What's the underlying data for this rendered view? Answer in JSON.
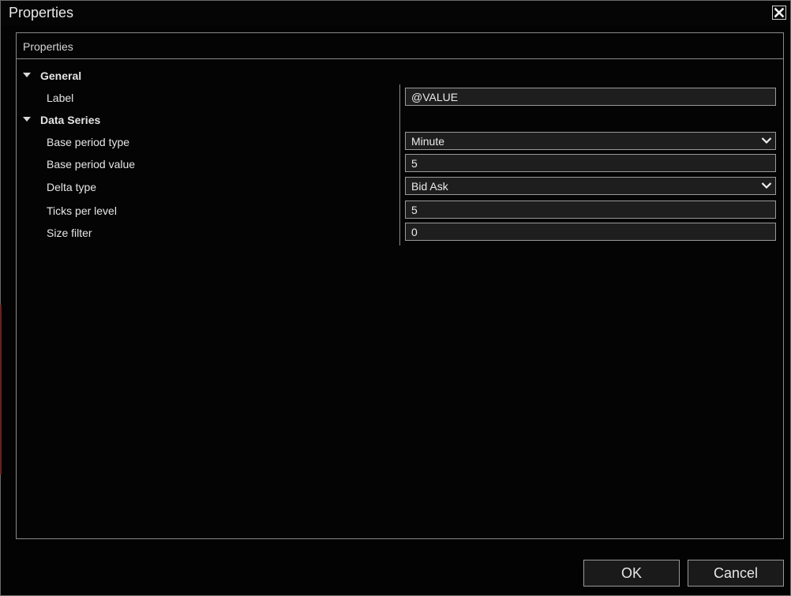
{
  "window": {
    "title": "Properties",
    "close_icon": "close-x-icon"
  },
  "panel": {
    "title": "Properties"
  },
  "categories": [
    {
      "label": "General",
      "expanded": true,
      "properties": [
        {
          "label": "Label",
          "value": "@VALUE",
          "kind": "text"
        }
      ]
    },
    {
      "label": "Data Series",
      "expanded": true,
      "properties": [
        {
          "label": "Base period type",
          "value": "Minute",
          "kind": "select"
        },
        {
          "label": "Base period value",
          "value": "5",
          "kind": "text"
        },
        {
          "label": "Delta type",
          "value": "Bid Ask",
          "kind": "select"
        },
        {
          "label": "Ticks per level",
          "value": "5",
          "kind": "text"
        },
        {
          "label": "Size filter",
          "value": "0",
          "kind": "text"
        }
      ]
    }
  ],
  "buttons": {
    "ok": "OK",
    "cancel": "Cancel"
  },
  "colors": {
    "background": "#030303",
    "border": "#8a8a8a",
    "field_background": "#1e1e1e",
    "text": "#e6e6e6"
  }
}
